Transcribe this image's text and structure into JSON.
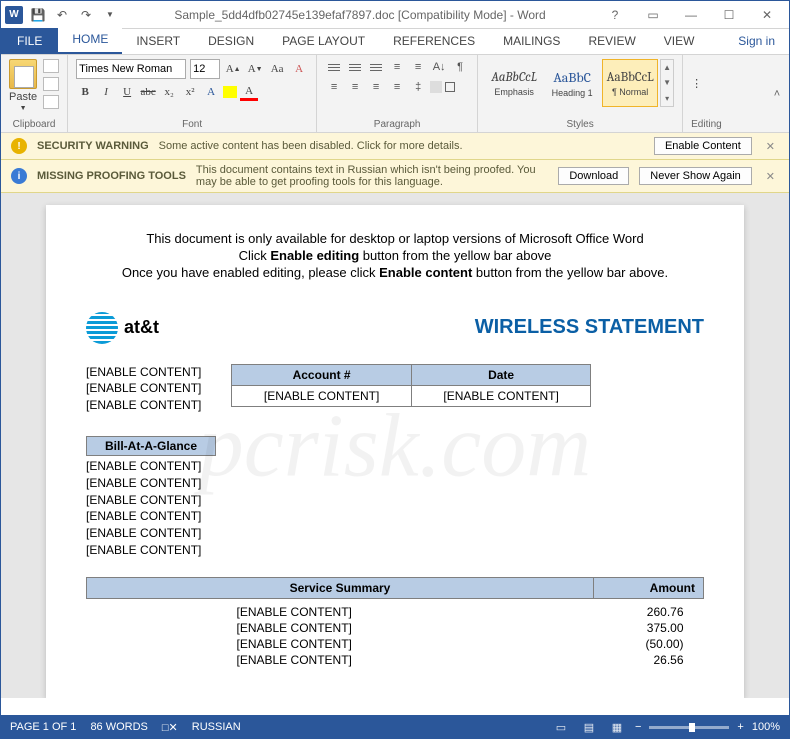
{
  "titlebar": {
    "title": "Sample_5dd4dfb02745e139efaf7897.doc [Compatibility Mode] - Word",
    "help": "?"
  },
  "tabs": {
    "file": "FILE",
    "items": [
      "HOME",
      "INSERT",
      "DESIGN",
      "PAGE LAYOUT",
      "REFERENCES",
      "MAILINGS",
      "REVIEW",
      "VIEW"
    ],
    "signin": "Sign in"
  },
  "ribbon": {
    "clipboard": {
      "paste": "Paste",
      "label": "Clipboard"
    },
    "font": {
      "name": "Times New Roman",
      "size": "12",
      "label": "Font"
    },
    "paragraph": {
      "label": "Paragraph"
    },
    "styles": {
      "items": [
        {
          "preview": "AaBbCcL",
          "name": "Emphasis"
        },
        {
          "preview": "AaBbC",
          "name": "Heading 1"
        },
        {
          "preview": "AaBbCcL",
          "name": "¶ Normal"
        }
      ],
      "label": "Styles"
    },
    "editing": {
      "label": "Editing"
    }
  },
  "warnings": {
    "security": {
      "title": "SECURITY WARNING",
      "text": "Some active content has been disabled. Click for more details.",
      "button": "Enable Content"
    },
    "proofing": {
      "title": "MISSING PROOFING TOOLS",
      "text": "This document contains text in Russian which isn't being proofed. You may be able to get proofing tools for this language.",
      "download": "Download",
      "never": "Never Show Again"
    }
  },
  "document": {
    "intro": {
      "l1": "This document is only available for desktop or laptop versions of Microsoft Office Word",
      "l2a": "Click ",
      "l2b": "Enable editing",
      "l2c": " button from the yellow bar above",
      "l3a": "Once you have enabled editing, please click ",
      "l3b": "Enable content",
      "l3c": " button from the yellow bar above."
    },
    "brand": "at&t",
    "statement_title": "WIRELESS STATEMENT",
    "placeholder": "[ENABLE CONTENT]",
    "account_header": "Account #",
    "date_header": "Date",
    "bill_glance": "Bill-At-A-Glance",
    "service_summary": "Service Summary",
    "amount": "Amount",
    "amounts": [
      "260.76",
      "375.00",
      "(50.00)",
      "26.56"
    ]
  },
  "statusbar": {
    "page": "PAGE 1 OF 1",
    "words": "86 WORDS",
    "lang": "RUSSIAN",
    "zoom": "100%"
  },
  "watermark": "pcrisk.com"
}
